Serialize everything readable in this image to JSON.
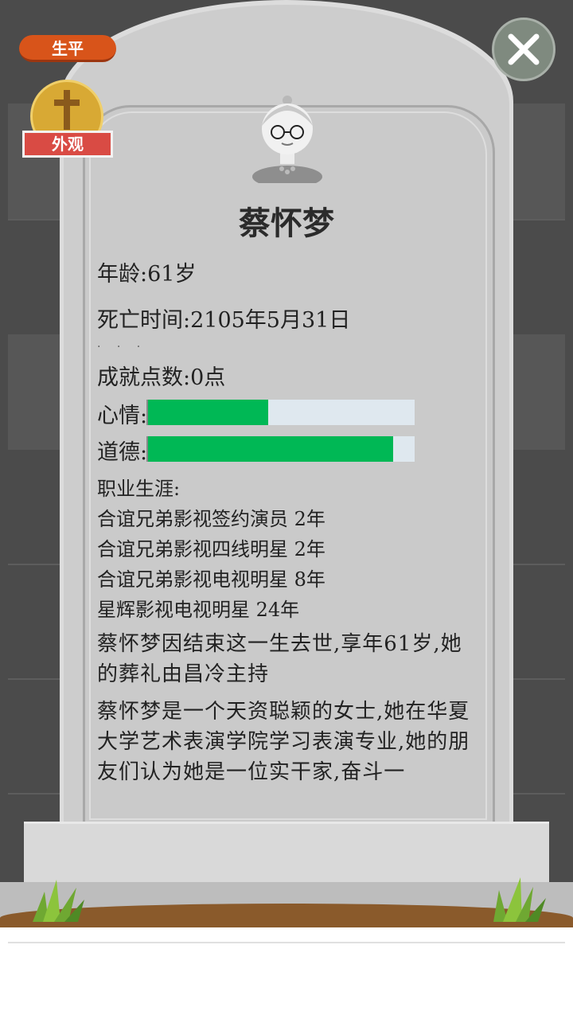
{
  "header": {
    "life_tab": "生平",
    "appearance_label": "外观"
  },
  "profile": {
    "name": "蔡怀梦",
    "age_line": "年龄:61岁",
    "death_time_line": "死亡时间:2105年5月31日",
    "achievement_line": "成就点数:0点",
    "mood_label": "心情:",
    "mood_level": 0.45,
    "morality_label": "道德:",
    "morality_level": 0.92,
    "career_title": "职业生涯:",
    "careers": [
      "合谊兄弟影视签约演员 2年",
      "合谊兄弟影视四线明星 2年",
      "合谊兄弟影视电视明星 8年",
      "星辉影视电视明星 24年"
    ],
    "death_paragraph": "蔡怀梦因结束这一生去世,享年61岁,她的葬礼由昌冷主持",
    "bio_paragraph": "蔡怀梦是一个天资聪颖的女士,她在华夏大学艺术表演学院学习表演专业,她的朋友们认为她是一位实干家,奋斗一"
  },
  "colors": {
    "bar_fill": "#00b855",
    "bar_track": "#dfe8ef",
    "tab_orange": "#d8541a",
    "ribbon_red": "#d94b44",
    "coin_gold": "#d8a934"
  },
  "icons": {
    "close": "close-icon",
    "cross": "cross-icon",
    "avatar": "elderly-woman-avatar"
  }
}
